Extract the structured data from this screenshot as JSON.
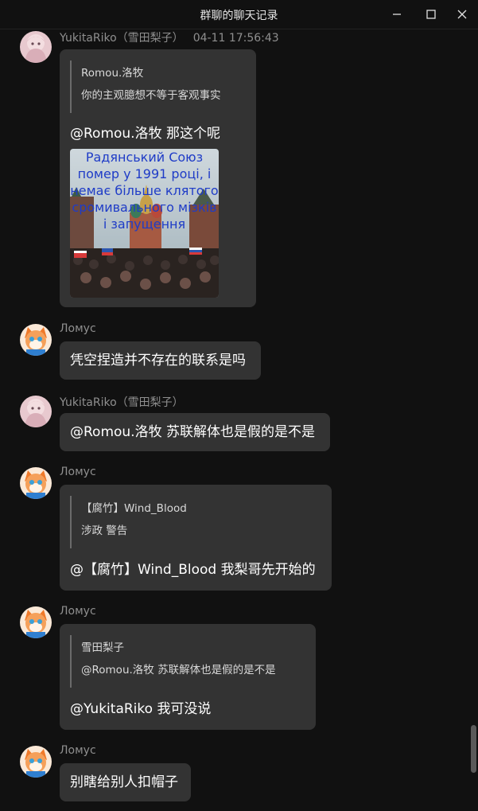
{
  "window": {
    "title": "群聊的聊天记录"
  },
  "messages": [
    {
      "sender": "YukitaRiko（雪田梨子）",
      "time": "04-11 17:56:43",
      "quote": {
        "name": "Romou.洛牧",
        "text": "你的主观臆想不等于客观事实"
      },
      "text": "@Romou.洛牧 那这个呢",
      "image_caption": "Радянський Союз помер у 1991 році, і немає більше клятого сромивального мізків і запущення"
    },
    {
      "sender": "Ломус",
      "text": "凭空捏造并不存在的联系是吗"
    },
    {
      "sender": "YukitaRiko（雪田梨子）",
      "text": "@Romou.洛牧 苏联解体也是假的是不是"
    },
    {
      "sender": "Ломус",
      "quote": {
        "name": "【腐竹】Wind_Blood",
        "text": "涉政 警告"
      },
      "text": "@【腐竹】Wind_Blood 我梨哥先开始的"
    },
    {
      "sender": "Ломус",
      "quote": {
        "name": "雪田梨子",
        "text": "@Romou.洛牧 苏联解体也是假的是不是"
      },
      "text": "@YukitaRiko 我可没说"
    },
    {
      "sender": "Ломус",
      "text": "别瞎给别人扣帽子"
    }
  ],
  "colors": {
    "background": "#111111",
    "bubble": "#333333",
    "sender_text": "#8f8f8f",
    "caption_text": "#1f3cc7"
  },
  "icons": [
    "minimize-icon",
    "maximize-icon",
    "close-icon"
  ]
}
